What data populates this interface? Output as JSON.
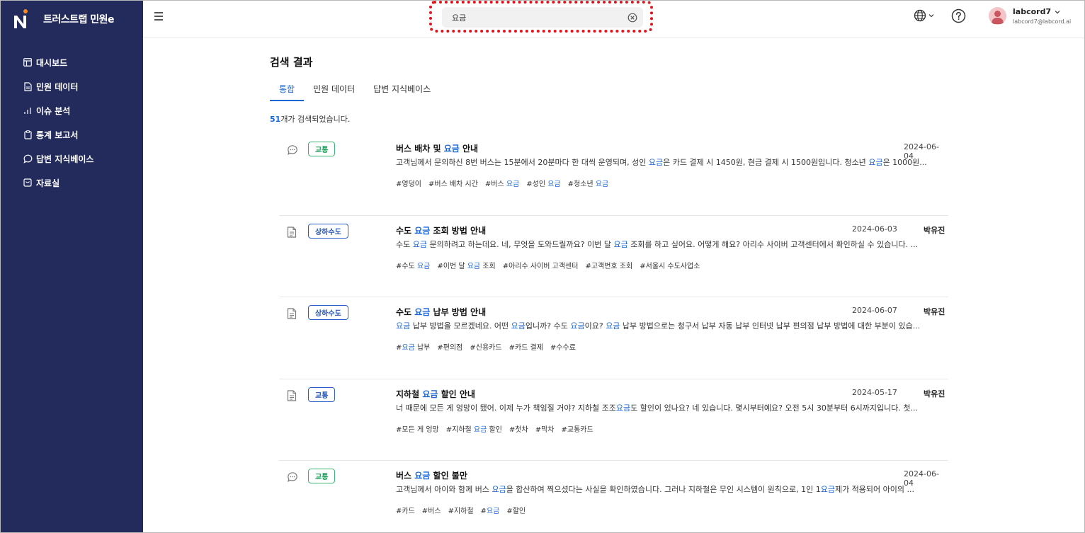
{
  "brand": {
    "name": "트러스트랩 민원e"
  },
  "sidebar": {
    "items": [
      {
        "label": "대시보드",
        "icon": "layout-icon"
      },
      {
        "label": "민원 데이터",
        "icon": "file-icon"
      },
      {
        "label": "이슈 분석",
        "icon": "bar-chart-icon"
      },
      {
        "label": "통계 보고서",
        "icon": "clipboard-icon"
      },
      {
        "label": "답변 지식베이스",
        "icon": "chat-icon"
      },
      {
        "label": "자료실",
        "icon": "archive-icon"
      }
    ]
  },
  "header": {
    "search_value": "요금",
    "user_name": "labcord7",
    "user_email": "labcord7@labcord.ai"
  },
  "main": {
    "title": "검색 결과",
    "tabs": [
      {
        "label": "통합"
      },
      {
        "label": "민원 데이터"
      },
      {
        "label": "답변 지식베이스"
      }
    ],
    "count_number": "51",
    "count_suffix": "개가 검색되었습니다.",
    "results": [
      {
        "type": "chat",
        "badge": "교통",
        "badge_color": "#1e9e5a",
        "title": [
          {
            "t": "버스 배차 및 "
          },
          {
            "t": "요금",
            "h": true
          },
          {
            "t": " 안내"
          }
        ],
        "date": "2024-06-04",
        "author": "",
        "body": [
          {
            "t": "고객님께서 문의하신 8번 버스는 15분에서 20분마다 한 대씩 운영되며, 성인 "
          },
          {
            "t": "요금",
            "h": true
          },
          {
            "t": "은 카드 결제 시 1450원, 현금 결제 시 1500원입니다. 청소년 "
          },
          {
            "t": "요금",
            "h": true
          },
          {
            "t": "은 1000원..."
          }
        ],
        "tags": [
          [
            {
              "t": "#영덩이"
            }
          ],
          [
            {
              "t": "#버스 배차 시간"
            }
          ],
          [
            {
              "t": "#버스 "
            },
            {
              "t": "요금",
              "h": true
            }
          ],
          [
            {
              "t": "#성인 "
            },
            {
              "t": "요금",
              "h": true
            }
          ],
          [
            {
              "t": "#청소년 "
            },
            {
              "t": "요금",
              "h": true
            }
          ]
        ]
      },
      {
        "type": "document",
        "badge": "상하수도",
        "badge_color": "#2353b5",
        "title": [
          {
            "t": "수도 "
          },
          {
            "t": "요금",
            "h": true
          },
          {
            "t": " 조회 방법 안내"
          }
        ],
        "date": "2024-06-03",
        "author": "박유진",
        "body": [
          {
            "t": "수도 "
          },
          {
            "t": "요금",
            "h": true
          },
          {
            "t": " 문의하려고 하는데요. 네, 무엇을 도와드릴까요? 이번 달 "
          },
          {
            "t": "요금",
            "h": true
          },
          {
            "t": " 조회를 하고 싶어요. 어떻게 해요? 아리수 사이버 고객센터에서 확인하실 수 있습니다. ..."
          }
        ],
        "tags": [
          [
            {
              "t": "#수도 "
            },
            {
              "t": "요금",
              "h": true
            }
          ],
          [
            {
              "t": "#이번 달 "
            },
            {
              "t": "요금",
              "h": true
            },
            {
              "t": " 조회"
            }
          ],
          [
            {
              "t": "#아리수 사이버 고객센터"
            }
          ],
          [
            {
              "t": "#고객번호 조회"
            }
          ],
          [
            {
              "t": "#서울시 수도사업소"
            }
          ]
        ]
      },
      {
        "type": "document",
        "badge": "상하수도",
        "badge_color": "#2353b5",
        "title": [
          {
            "t": "수도 "
          },
          {
            "t": "요금",
            "h": true
          },
          {
            "t": " 납부 방법 안내"
          }
        ],
        "date": "2024-06-07",
        "author": "박유진",
        "body": [
          {
            "t": "요금",
            "h": true
          },
          {
            "t": " 납부 방법을 모르겠네요. 어떤 "
          },
          {
            "t": "요금",
            "h": true
          },
          {
            "t": "입니까? 수도 "
          },
          {
            "t": "요금",
            "h": true
          },
          {
            "t": "이요? "
          },
          {
            "t": "요금",
            "h": true
          },
          {
            "t": " 납부 방법으로는 청구서 납부 자동 납부 인터넷 납부 편의점 납부 방법에 대한 부분이 있습..."
          }
        ],
        "tags": [
          [
            {
              "t": "#"
            },
            {
              "t": "요금",
              "h": true
            },
            {
              "t": " 납부"
            }
          ],
          [
            {
              "t": "#편의점"
            }
          ],
          [
            {
              "t": "#신용카드"
            }
          ],
          [
            {
              "t": "#카드 결제"
            }
          ],
          [
            {
              "t": "#수수료"
            }
          ]
        ]
      },
      {
        "type": "document",
        "badge": "교통",
        "badge_color": "#2353b5",
        "title": [
          {
            "t": "지하철 "
          },
          {
            "t": "요금",
            "h": true
          },
          {
            "t": " 할인 안내"
          }
        ],
        "date": "2024-05-17",
        "author": "박유진",
        "body": [
          {
            "t": "너 때문에 모든 게 엉망이 됐어. 이제 누가 책임질 거야? 지하철 조조"
          },
          {
            "t": "요금",
            "h": true
          },
          {
            "t": "도 할인이 있나요? 네 있습니다. 몇시부터예요? 오전 5시 30분부터 6시까지입니다. 첫..."
          }
        ],
        "tags": [
          [
            {
              "t": "#모든 게 엉망"
            }
          ],
          [
            {
              "t": "#지하철 "
            },
            {
              "t": "요금",
              "h": true
            },
            {
              "t": " 할인"
            }
          ],
          [
            {
              "t": "#첫차"
            }
          ],
          [
            {
              "t": "#막차"
            }
          ],
          [
            {
              "t": "#교통카드"
            }
          ]
        ]
      },
      {
        "type": "chat",
        "badge": "교통",
        "badge_color": "#1e9e5a",
        "title": [
          {
            "t": "버스 "
          },
          {
            "t": "요금",
            "h": true
          },
          {
            "t": " 할인 불만"
          }
        ],
        "date": "2024-06-04",
        "author": "",
        "body": [
          {
            "t": "고객님께서 아이와 함께 버스 "
          },
          {
            "t": "요금",
            "h": true
          },
          {
            "t": "을 합산하여 찍으셨다는 사실을 확인하였습니다. 그러나 지하철은 무인 시스템이 원칙으로, 1인 1"
          },
          {
            "t": "요금",
            "h": true
          },
          {
            "t": "제가 적용되어 아이의 ..."
          }
        ],
        "tags": [
          [
            {
              "t": "#카드"
            }
          ],
          [
            {
              "t": "#버스"
            }
          ],
          [
            {
              "t": "#지하철"
            }
          ],
          [
            {
              "t": "#"
            },
            {
              "t": "요금",
              "h": true
            }
          ],
          [
            {
              "t": "#할인"
            }
          ]
        ]
      }
    ]
  }
}
